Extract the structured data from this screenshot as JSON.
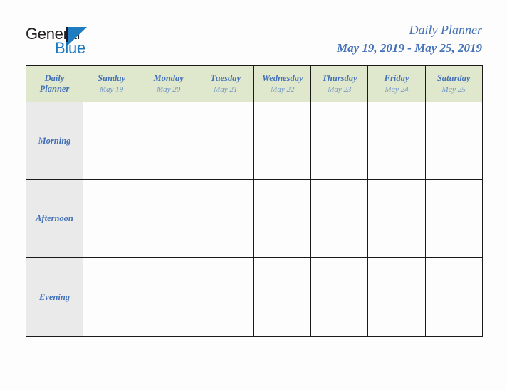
{
  "brand": {
    "name_part1": "General",
    "name_part2": "Blue",
    "triangle_icon": "brand-triangle-icon",
    "accent_color": "#1878be",
    "dark_color": "#231f20"
  },
  "header": {
    "title": "Daily Planner",
    "date_range": "May 19, 2019 - May 25, 2019",
    "title_color": "#4472b8"
  },
  "table": {
    "corner_label_line1": "Daily",
    "corner_label_line2": "Planner",
    "header_bg": "#dfe8cc",
    "row_label_bg": "#eaeaea",
    "border_color": "#1a1a1a",
    "columns": [
      {
        "day": "Sunday",
        "date": "May 19"
      },
      {
        "day": "Monday",
        "date": "May 20"
      },
      {
        "day": "Tuesday",
        "date": "May 21"
      },
      {
        "day": "Wednesday",
        "date": "May 22"
      },
      {
        "day": "Thursday",
        "date": "May 23"
      },
      {
        "day": "Friday",
        "date": "May 24"
      },
      {
        "day": "Saturday",
        "date": "May 25"
      }
    ],
    "rows": [
      {
        "label": "Morning",
        "cells": [
          "",
          "",
          "",
          "",
          "",
          "",
          ""
        ]
      },
      {
        "label": "Afternoon",
        "cells": [
          "",
          "",
          "",
          "",
          "",
          "",
          ""
        ]
      },
      {
        "label": "Evening",
        "cells": [
          "",
          "",
          "",
          "",
          "",
          "",
          ""
        ]
      }
    ]
  }
}
